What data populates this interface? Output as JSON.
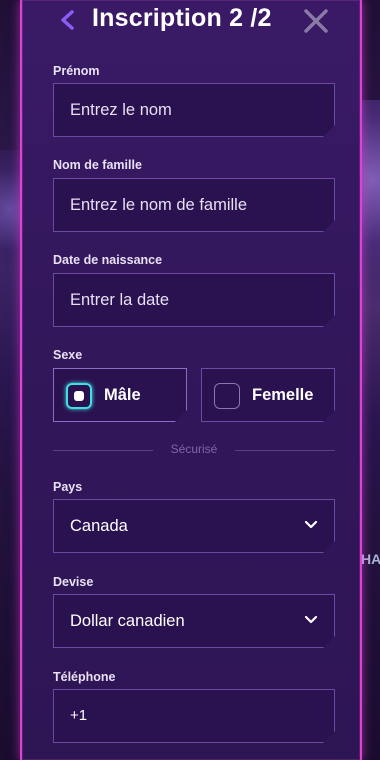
{
  "header": {
    "title": "Inscription 2 /2"
  },
  "fields": {
    "first_name": {
      "label": "Prénom",
      "placeholder": "Entrez le nom"
    },
    "last_name": {
      "label": "Nom de famille",
      "placeholder": "Entrez le nom de famille"
    },
    "birth_date": {
      "label": "Date de naissance",
      "placeholder": "Entrer la date"
    },
    "gender": {
      "label": "Sexe",
      "options": [
        "Mâle",
        "Femelle"
      ],
      "selected": "Mâle"
    },
    "divider_text": "Sécurisé",
    "country": {
      "label": "Pays",
      "value": "Canada"
    },
    "currency": {
      "label": "Devise",
      "value": "Dollar canadien"
    },
    "phone": {
      "label": "Téléphone",
      "value": "+1"
    }
  },
  "background": {
    "side_text": "HAI"
  },
  "colors": {
    "accent_border": "#e23fd6",
    "modal_bg": "#33175c",
    "field_bg": "#2a1150",
    "back_arrow": "#8b5cf6",
    "radio_selected": "#40e0e0"
  }
}
